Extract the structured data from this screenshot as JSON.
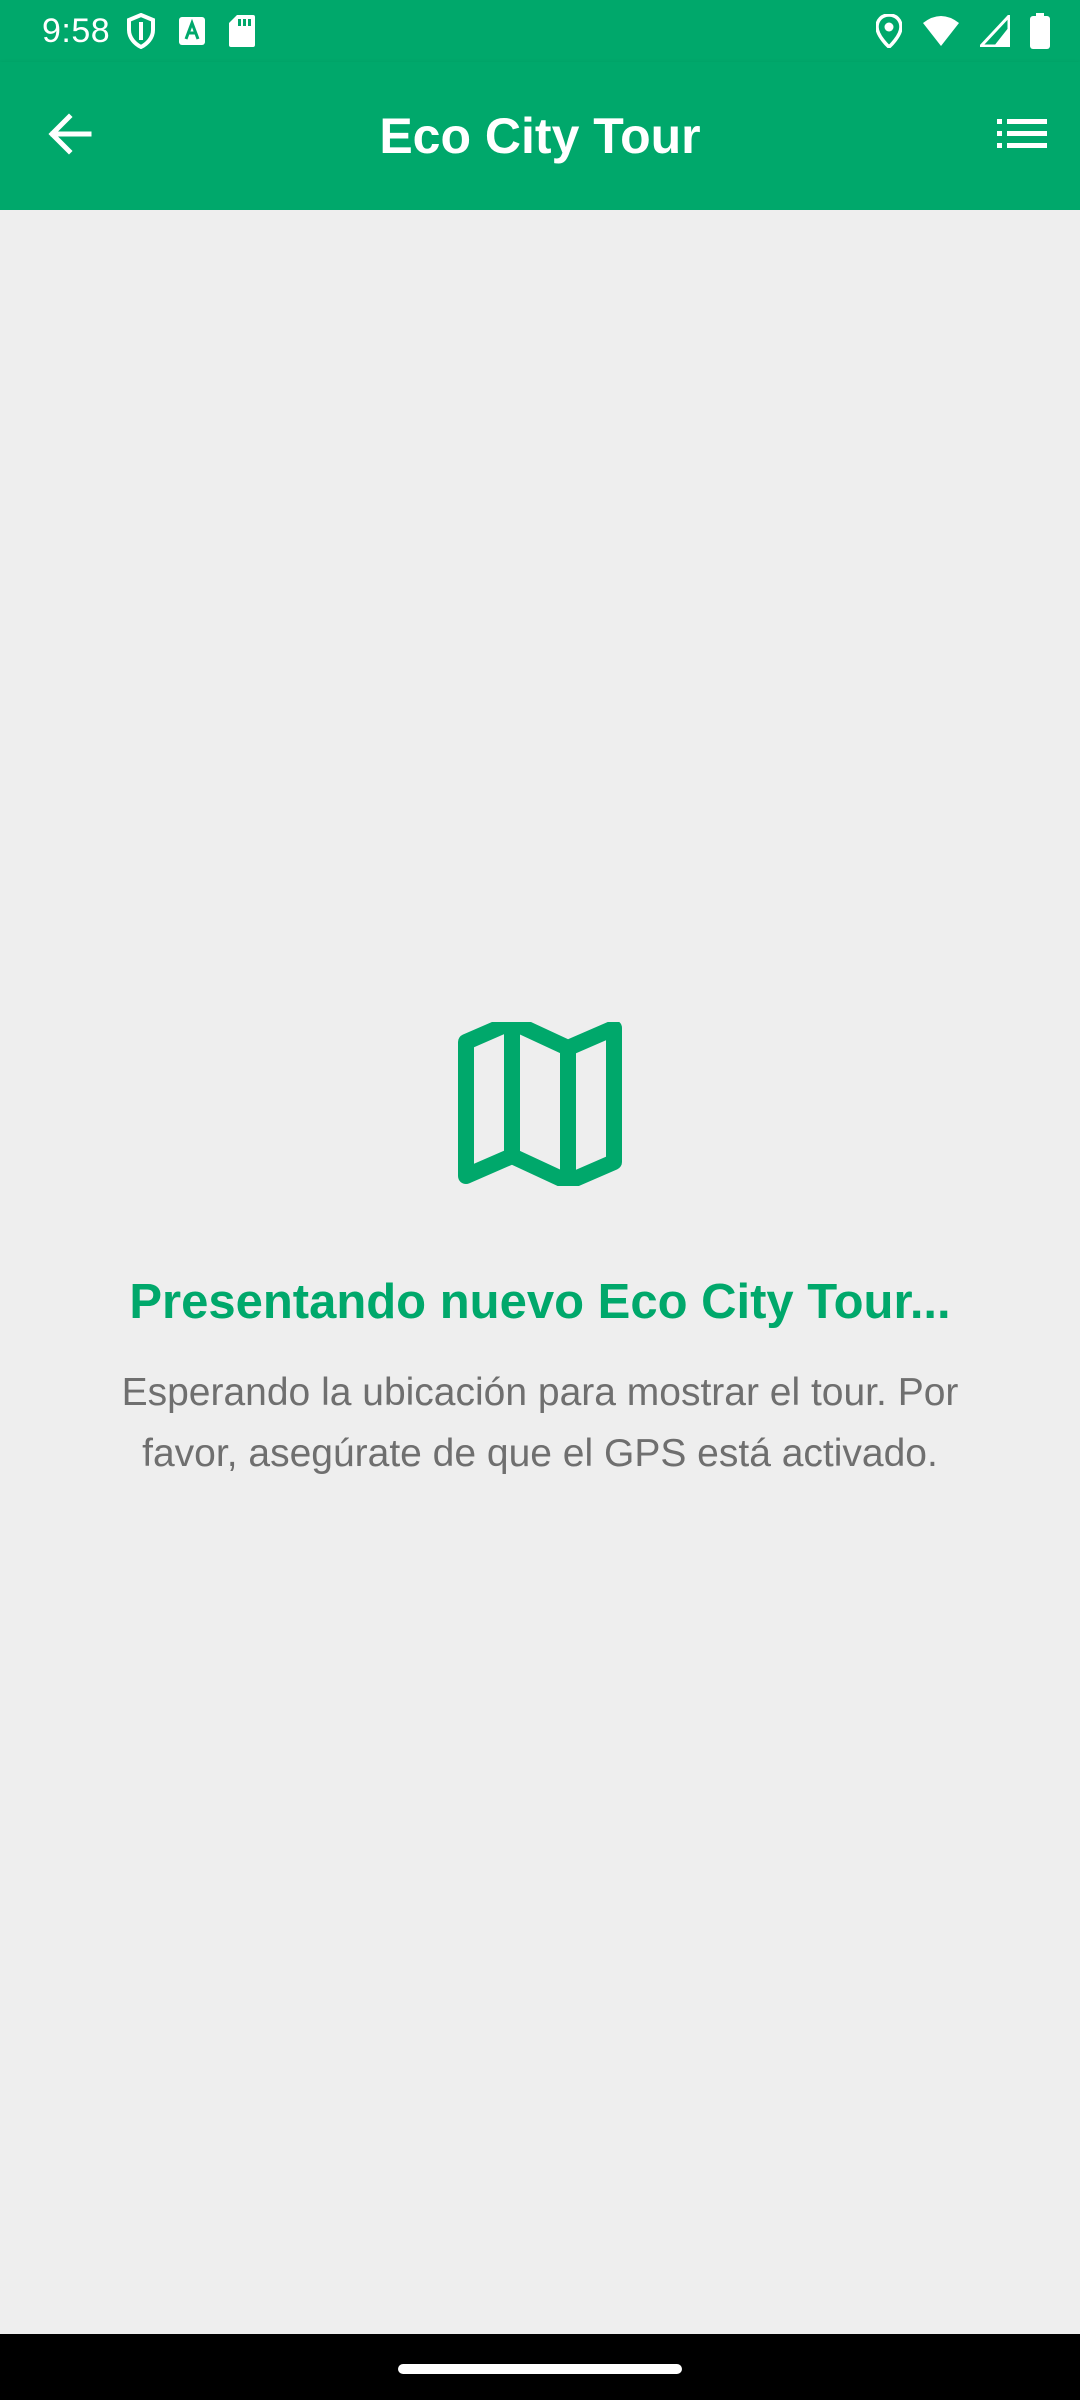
{
  "status_bar": {
    "time": "9:58",
    "left_icons": [
      "shield-icon",
      "text-a-icon",
      "sd-card-icon"
    ],
    "right_icons": [
      "location-icon",
      "wifi-icon",
      "signal-icon",
      "battery-icon"
    ]
  },
  "app_bar": {
    "title": "Eco City Tour",
    "back_icon": "arrow-back-icon",
    "menu_icon": "list-icon"
  },
  "main": {
    "icon": "map-icon",
    "heading": "Presentando nuevo Eco City Tour...",
    "message": "Esperando la ubicación para mostrar el tour. Por favor, asegúrate de que el GPS está activado."
  },
  "colors": {
    "brand": "#00a86b",
    "background": "#eeeeee",
    "message_text": "#6f6f6f"
  }
}
